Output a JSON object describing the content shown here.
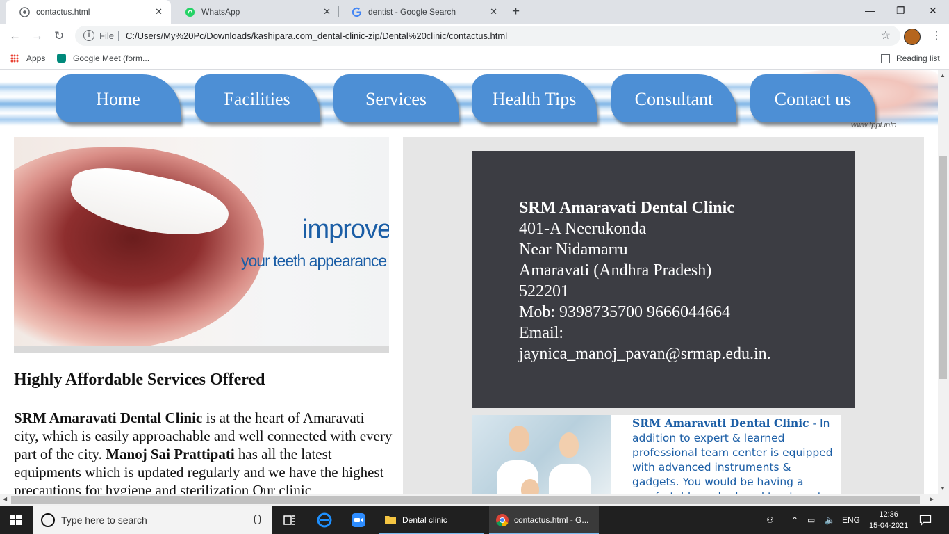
{
  "browser": {
    "tabs": [
      {
        "title": "contactus.html",
        "icon": "globe-icon",
        "active": true
      },
      {
        "title": "WhatsApp",
        "icon": "whatsapp-icon",
        "active": false
      },
      {
        "title": "dentist - Google Search",
        "icon": "google-icon",
        "active": false
      }
    ],
    "close_glyph": "✕",
    "new_tab_glyph": "+",
    "window_controls": {
      "minimize": "—",
      "maximize": "❐",
      "close": "✕"
    },
    "nav": {
      "back": "←",
      "forward": "→",
      "reload": "↻"
    },
    "address": {
      "scheme_label": "File",
      "url": "C:/Users/My%20Pc/Downloads/kashipara.com_dental-clinic-zip/Dental%20clinic/contactus.html"
    },
    "star_glyph": "☆",
    "menu_glyph": "⋮",
    "bookmarks": [
      {
        "label": "Apps",
        "icon": "apps-grid-icon"
      },
      {
        "label": "Google Meet (form...",
        "icon": "google-meet-icon"
      }
    ],
    "reading_list": "Reading list"
  },
  "page": {
    "banner_watermark": "www.fppt.info",
    "nav": [
      "Home",
      "Facilities",
      "Services",
      "Health Tips",
      "Consultant",
      "Contact us"
    ],
    "hero": {
      "word1": "improve",
      "word2": "your teeth appearance"
    },
    "heading": "Highly Affordable Services Offered",
    "paragraph": {
      "bold1": "SRM Amaravati Dental Clinic",
      "text1": " is at the heart of Amaravati city, which is easily approachable and well connected with every part of the city. ",
      "bold2": "Manoj Sai Prattipati",
      "text2": " has all the latest equipments which is updated regularly and we have the highest precautions for hygiene and sterilization Our clinic"
    },
    "contact": {
      "title": "SRM Amaravati Dental Clinic",
      "line1": "401-A   Neerukonda",
      "line2": "Near Nidamarru",
      "line3": "Amaravati   (Andhra Pradesh)",
      "line4": "522201",
      "line5": "Mob:   9398735700   9666044664",
      "line6": "Email:",
      "line7": "jaynica_manoj_pavan@srmap.edu.in."
    },
    "team": {
      "bold": "SRM Amaravati Dental Clinic",
      "text": " - In addition to expert & learned professional team center is equipped with advanced instruments & gadgets. You would be having a comfortable and relaxed treatment"
    }
  },
  "taskbar": {
    "search_placeholder": "Type here to search",
    "apps": [
      {
        "label": "Dental clinic",
        "icon": "folder-icon"
      },
      {
        "label": "contactus.html - G...",
        "icon": "chrome-icon"
      }
    ],
    "language": "ENG",
    "time": "12:36",
    "date": "15-04-2021"
  }
}
